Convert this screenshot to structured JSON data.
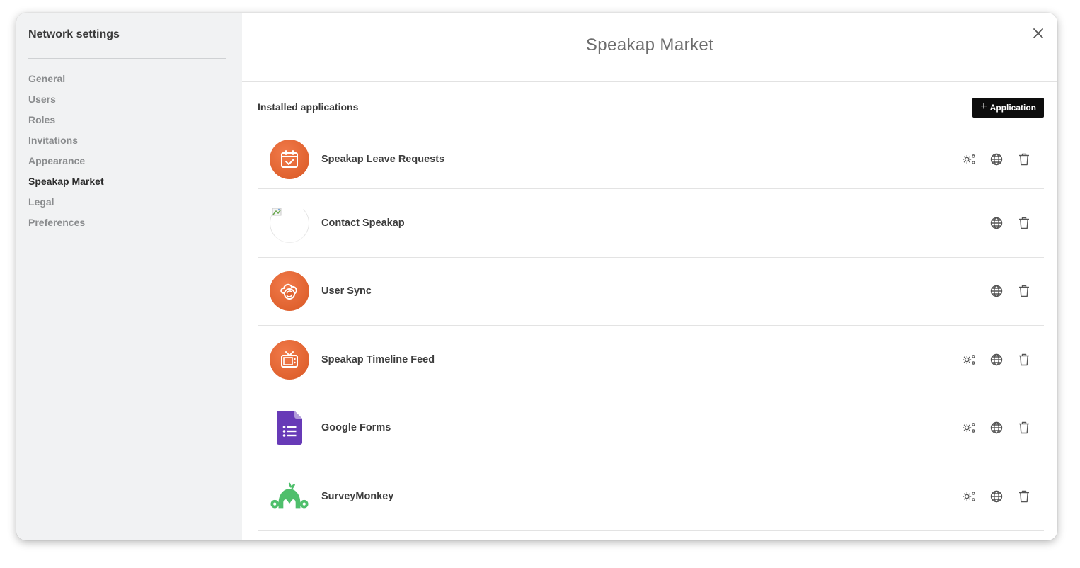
{
  "sidebar": {
    "title": "Network settings",
    "items": [
      {
        "label": "General",
        "active": false
      },
      {
        "label": "Users",
        "active": false
      },
      {
        "label": "Roles",
        "active": false
      },
      {
        "label": "Invitations",
        "active": false
      },
      {
        "label": "Appearance",
        "active": false
      },
      {
        "label": "Speakap Market",
        "active": true
      },
      {
        "label": "Legal",
        "active": false
      },
      {
        "label": "Preferences",
        "active": false
      }
    ]
  },
  "main": {
    "title": "Speakap Market",
    "close_icon": "close-icon",
    "section_title": "Installed applications",
    "add_button": {
      "plus": "+",
      "label": "Application"
    },
    "apps": [
      {
        "name": "Speakap Leave Requests",
        "icon": "calendar-check-icon",
        "has_settings": true
      },
      {
        "name": "Contact Speakap",
        "icon": "broken-image-icon",
        "has_settings": false
      },
      {
        "name": "User Sync",
        "icon": "cloud-sync-icon",
        "has_settings": false
      },
      {
        "name": "Speakap Timeline Feed",
        "icon": "tv-icon",
        "has_settings": true
      },
      {
        "name": "Google Forms",
        "icon": "google-forms-icon",
        "has_settings": true
      },
      {
        "name": "SurveyMonkey",
        "icon": "surveymonkey-icon",
        "has_settings": true
      }
    ]
  },
  "colors": {
    "sidebar_bg": "#f1f2f3",
    "accent_orange": "#e0622f",
    "button_bg": "#0d0d0d",
    "google_forms_purple": "#673ab7",
    "surveymonkey_green": "#4fbf6c"
  }
}
